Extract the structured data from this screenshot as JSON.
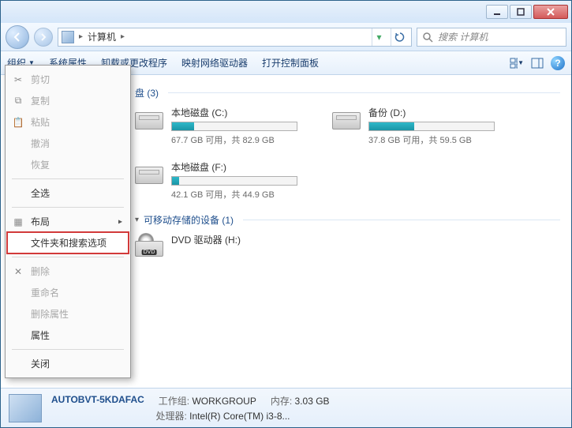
{
  "titlebar": {},
  "nav": {
    "crumb_root": "计算机",
    "search_placeholder": "搜索 计算机"
  },
  "toolbar": {
    "organize": "组织",
    "system_props": "系统属性",
    "uninstall": "卸载或更改程序",
    "map_drive": "映射网络驱动器",
    "control_panel": "打开控制面板"
  },
  "organize_menu": {
    "cut": "剪切",
    "copy": "复制",
    "paste": "粘贴",
    "undo": "撤消",
    "redo": "恢复",
    "select_all": "全选",
    "layout": "布局",
    "folder_options": "文件夹和搜索选项",
    "delete": "删除",
    "rename": "重命名",
    "remove_props": "删除属性",
    "properties": "属性",
    "close": "关闭"
  },
  "groups": {
    "hdd": {
      "title": "硬盘 (3)",
      "visible_title": "盘 (3)"
    },
    "removable": {
      "title": "可移动存储的设备 (1)",
      "visible_title": "可移动存储的设备 (1)"
    }
  },
  "drives": [
    {
      "name": "本地磁盘 (C:)",
      "free": "67.7 GB",
      "total": "82.9 GB",
      "stat": "67.7 GB 可用，共 82.9 GB",
      "pct": 18
    },
    {
      "name": "备份 (D:)",
      "free": "37.8 GB",
      "total": "59.5 GB",
      "stat": "37.8 GB 可用，共 59.5 GB",
      "pct": 36
    },
    {
      "name": "本地磁盘 (F:)",
      "free": "42.1 GB",
      "total": "44.9 GB",
      "stat": "42.1 GB 可用，共 44.9 GB",
      "pct": 6
    }
  ],
  "removable": [
    {
      "name": "DVD 驱动器 (H:)"
    }
  ],
  "statusbar": {
    "computer_name": "AUTOBVT-5KDAFAC",
    "workgroup_label": "工作组:",
    "workgroup": "WORKGROUP",
    "mem_label": "内存:",
    "mem": "3.03 GB",
    "cpu_label": "处理器:",
    "cpu": "Intel(R) Core(TM) i3-8..."
  }
}
